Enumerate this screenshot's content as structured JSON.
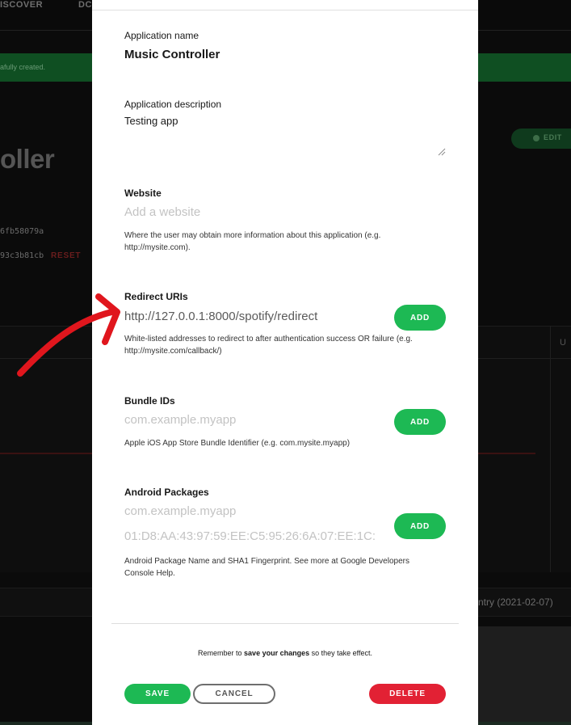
{
  "background": {
    "nav": [
      "ISCOVER",
      "DC"
    ],
    "banner_text": "afully created.",
    "app_title_fragment": "oller",
    "edit_button": "EDIT",
    "client_id_fragment": "6fb58079a",
    "client_secret_fragment": "93c3b81cb",
    "reset_label": "RESET",
    "column_fragment": "U",
    "footer_fragment": "ntry (2021-02-07)"
  },
  "modal": {
    "app_name": {
      "label": "Application name",
      "value": "Music Controller"
    },
    "app_description": {
      "label": "Application description",
      "value": "Testing app"
    },
    "website": {
      "label": "Website",
      "placeholder": "Add a website",
      "help_line1": "Where the user may obtain more information about this application (e.g.",
      "help_line2": "http://mysite.com)."
    },
    "redirect_uris": {
      "label": "Redirect URIs",
      "value": "http://127.0.0.1:8000/spotify/redirect",
      "add_label": "ADD",
      "help_line1": "White-listed addresses to redirect to after authentication success OR failure (e.g.",
      "help_line2": "http://mysite.com/callback/)"
    },
    "bundle_ids": {
      "label": "Bundle IDs",
      "placeholder": "com.example.myapp",
      "add_label": "ADD",
      "help": "Apple iOS App Store Bundle Identifier (e.g. com.mysite.myapp)"
    },
    "android_packages": {
      "label": "Android Packages",
      "package_placeholder": "com.example.myapp",
      "fingerprint_placeholder": "01:D8:AA:43:97:59:EE:C5:95:26:6A:07:EE:1C:",
      "add_label": "ADD",
      "help_line1": "Android Package Name and SHA1 Fingerprint. See more at Google Developers",
      "help_line2": "Console Help."
    },
    "reminder": {
      "before": "Remember to ",
      "bold": "save your changes",
      "after": " so they take effect."
    },
    "buttons": {
      "save": "SAVE",
      "cancel": "CANCEL",
      "delete": "DELETE"
    }
  },
  "colors": {
    "accent_green": "#1db954",
    "danger_red": "#e22134",
    "annotation_red": "#e0161d"
  },
  "annotation": {
    "icon": "red-arrow-icon"
  }
}
